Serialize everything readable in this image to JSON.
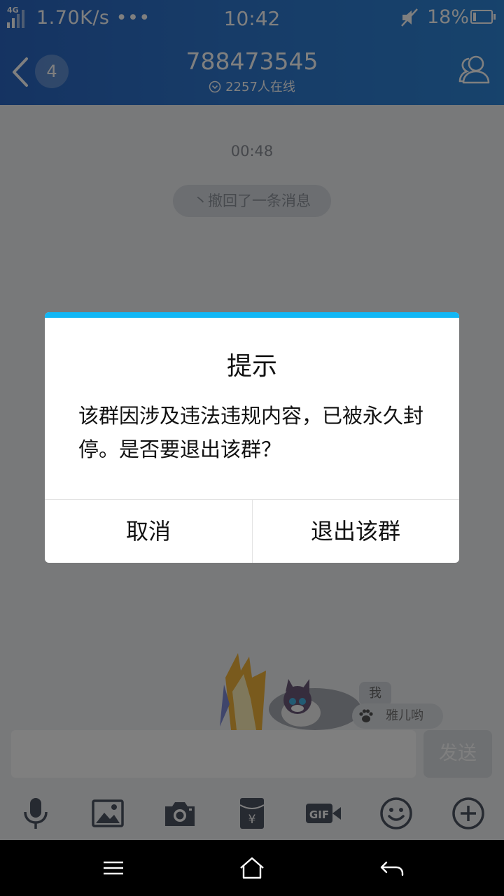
{
  "status_bar": {
    "network_type": "4G",
    "speed": "1.70K/s •••",
    "time": "10:42",
    "battery_percent": "18%",
    "battery_level": 0.18,
    "icons": [
      "signal-icon",
      "mute-icon",
      "battery-icon"
    ]
  },
  "header": {
    "back_icon": "back-chevron-icon",
    "unread_count": "4",
    "group_id": "788473545",
    "online_count": "2257人在线",
    "members_icon": "group-members-icon"
  },
  "chat": {
    "timestamp": "00:48",
    "recall_notice": "丶撤回了一条消息",
    "me_tag": "我",
    "nickname": "雅儿哟"
  },
  "input": {
    "value": "",
    "send_label": "发送"
  },
  "toolbar": {
    "items": [
      "microphone-icon",
      "image-icon",
      "camera-icon",
      "red-packet-icon",
      "gif-icon",
      "emoji-icon",
      "plus-icon"
    ]
  },
  "dialog": {
    "title": "提示",
    "message": "该群因涉及违法违规内容，已被永久封停。是否要退出该群？",
    "cancel_label": "取消",
    "confirm_label": "退出该群",
    "accent_color": "#12b7f5"
  },
  "nav_bar": {
    "items": [
      "menu-icon",
      "home-icon",
      "back-icon"
    ]
  },
  "colors": {
    "header_gradient_start": "#2a67c4",
    "header_gradient_end": "#2e86d8",
    "overlay": "rgba(0,0,0,0.5)"
  }
}
